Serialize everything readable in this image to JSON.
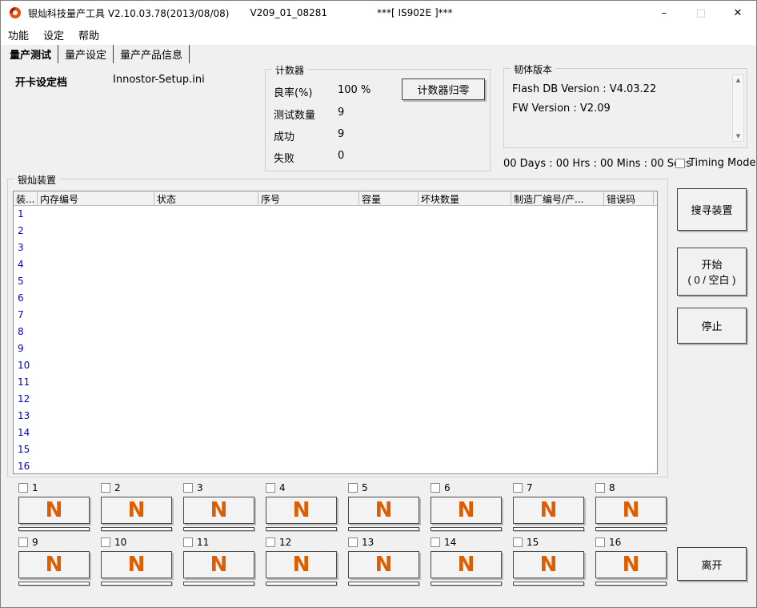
{
  "window": {
    "title": "银灿科技量产工具 V2.10.03.78(2013/08/08)",
    "version": "V209_01_08281",
    "center_title": "***[ IS902E ]***",
    "controls": {
      "minimize": "–",
      "maximize": "□",
      "close": "✕"
    }
  },
  "menu": {
    "items": [
      "功能",
      "设定",
      "帮助"
    ]
  },
  "tabs": {
    "items": [
      "量产测试",
      "量产设定",
      "量产产品信息"
    ],
    "active": "量产测试"
  },
  "config": {
    "label": "开卡设定档",
    "file": "Innostor-Setup.ini"
  },
  "counter": {
    "title": "计数器",
    "yield_label": "良率(%)",
    "yield_value": "100 %",
    "tested_label": "测试数量",
    "tested_value": "9",
    "success_label": "成功",
    "success_value": "9",
    "fail_label": "失败",
    "fail_value": "0",
    "reset_button": "计数器归零"
  },
  "firmware": {
    "title": "韧体版本",
    "flash_db_line": "Flash DB Version :  V4.03.22",
    "fw_line": "FW Version :  V2.09",
    "scroll_up_icon": "▲",
    "scroll_down_icon": "▼"
  },
  "timer": {
    "elapsed": "00 Days : 00 Hrs : 00 Mins : 00 Secs",
    "timing_mode_label": "Timing Mode"
  },
  "devices": {
    "title": "银灿装置",
    "columns": [
      "装...",
      "内存编号",
      "状态",
      "序号",
      "容量",
      "坏块数量",
      "制造厂编号/产...",
      "错误码"
    ],
    "rows": [
      {
        "index": "1"
      },
      {
        "index": "2"
      },
      {
        "index": "3"
      },
      {
        "index": "4"
      },
      {
        "index": "5"
      },
      {
        "index": "6"
      },
      {
        "index": "7"
      },
      {
        "index": "8"
      },
      {
        "index": "9"
      },
      {
        "index": "10"
      },
      {
        "index": "11"
      },
      {
        "index": "12"
      },
      {
        "index": "13"
      },
      {
        "index": "14"
      },
      {
        "index": "15"
      },
      {
        "index": "16"
      }
    ]
  },
  "buttons": {
    "search": "搜寻装置",
    "start_line1": "开始",
    "start_line2": "( 0 / 空白 )",
    "stop": "停止",
    "exit": "离开"
  },
  "slots": {
    "items": [
      {
        "num": "1",
        "status": "N"
      },
      {
        "num": "2",
        "status": "N"
      },
      {
        "num": "3",
        "status": "N"
      },
      {
        "num": "4",
        "status": "N"
      },
      {
        "num": "5",
        "status": "N"
      },
      {
        "num": "6",
        "status": "N"
      },
      {
        "num": "7",
        "status": "N"
      },
      {
        "num": "8",
        "status": "N"
      },
      {
        "num": "9",
        "status": "N"
      },
      {
        "num": "10",
        "status": "N"
      },
      {
        "num": "11",
        "status": "N"
      },
      {
        "num": "12",
        "status": "N"
      },
      {
        "num": "13",
        "status": "N"
      },
      {
        "num": "14",
        "status": "N"
      },
      {
        "num": "15",
        "status": "N"
      },
      {
        "num": "16",
        "status": "N"
      }
    ]
  },
  "colors": {
    "accent_orange": "#dd5e00",
    "row_number_blue": "#0000d4"
  }
}
